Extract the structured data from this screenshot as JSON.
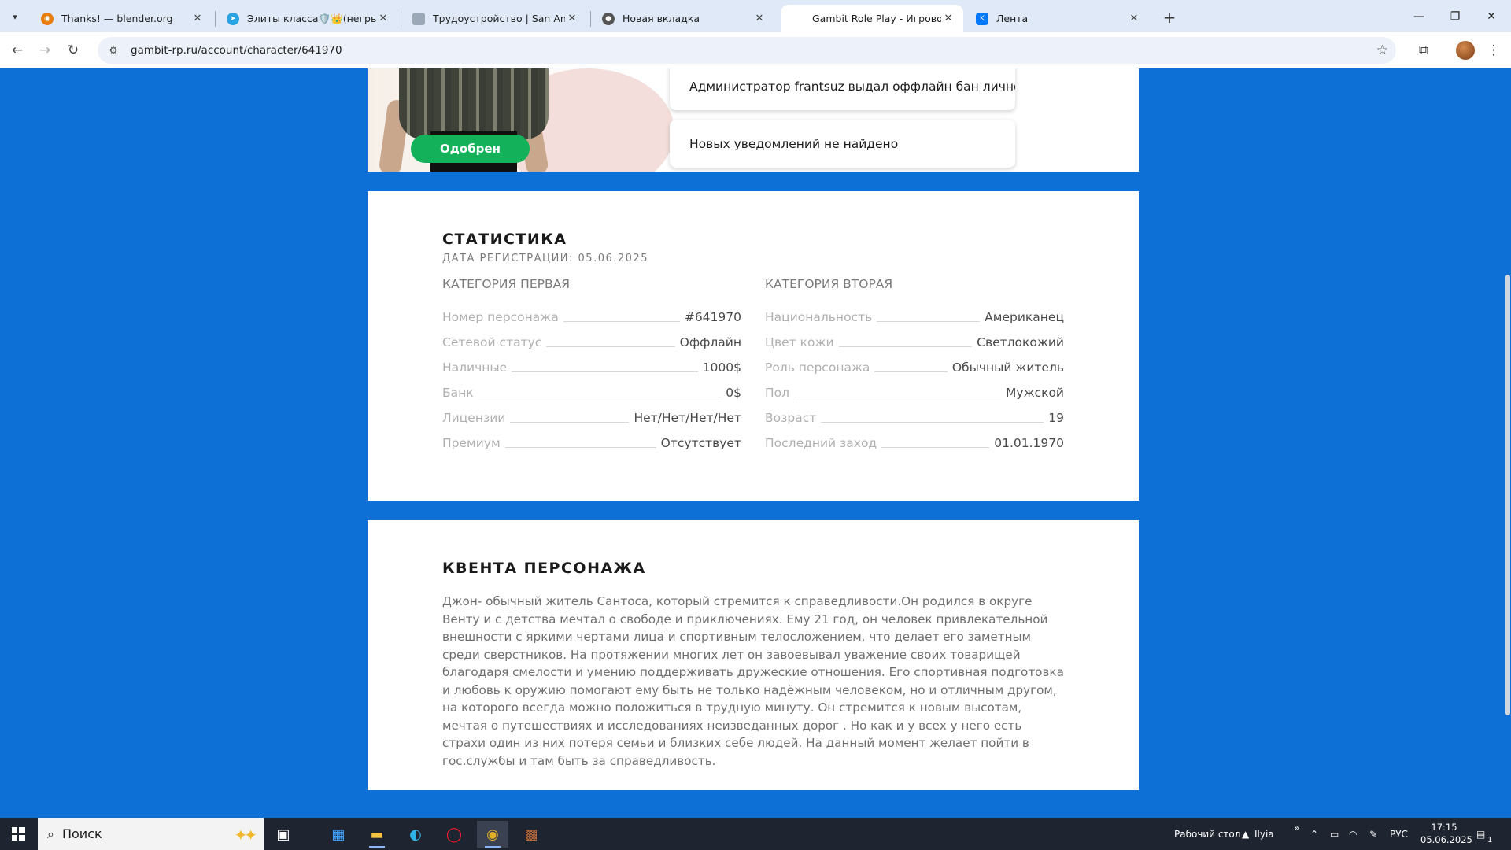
{
  "browser": {
    "tabs": [
      {
        "title": "Thanks! — blender.org",
        "icon": "blender-icon",
        "color": "#e87d0d"
      },
      {
        "title": "Элиты класса🛡️👑(негры)",
        "icon": "telegram-icon",
        "color": "#2aa3e0"
      },
      {
        "title": "Трудоустройство | San Andreas",
        "icon": "page-icon",
        "color": "#9aa8b8"
      },
      {
        "title": "Новая вкладка",
        "icon": "chrome-icon",
        "color": "#555555"
      },
      {
        "title": "Gambit Role Play - Игровой пр",
        "icon": "gambit-icon",
        "color": "#ffffff"
      },
      {
        "title": "Лента",
        "icon": "vk-icon",
        "color": "#0077ff"
      }
    ],
    "new_tab_label": "+",
    "url": "gambit-rp.ru/account/character/641970"
  },
  "character": {
    "status_badge": "Одобрен",
    "notifications": [
      "Администратор frantsuz выдал оффлайн бан лично...",
      "Новых уведомлений не найдено"
    ]
  },
  "stats": {
    "title": "СТАТИСТИКА",
    "registration": "ДАТА РЕГИСТРАЦИИ: 05.06.2025",
    "category_one": {
      "title": "КАТЕГОРИЯ ПЕРВАЯ",
      "rows": [
        {
          "label": "Номер персонажа",
          "value": "#641970"
        },
        {
          "label": "Сетевой статус",
          "value": "Оффлайн"
        },
        {
          "label": "Наличные",
          "value": "1000$"
        },
        {
          "label": "Банк",
          "value": "0$"
        },
        {
          "label": "Лицензии",
          "value": "Нет/Нет/Нет/Нет"
        },
        {
          "label": "Премиум",
          "value": "Отсутствует"
        }
      ]
    },
    "category_two": {
      "title": "КАТЕГОРИЯ ВТОРАЯ",
      "rows": [
        {
          "label": "Национальность",
          "value": "Американец"
        },
        {
          "label": "Цвет кожи",
          "value": "Светлокожий"
        },
        {
          "label": "Роль персонажа",
          "value": "Обычный житель"
        },
        {
          "label": "Пол",
          "value": "Мужской"
        },
        {
          "label": "Возраст",
          "value": "19"
        },
        {
          "label": "Последний заход",
          "value": "01.01.1970"
        }
      ]
    }
  },
  "story": {
    "title": "КВЕНТА ПЕРСОНАЖА",
    "text": "Джон- обычный житель Сантоса, который стремится к справедливости.Он родился в округе Венту и с детства мечтал о свободе и приключениях. Ему 21 год, он человек привлекательной внешности с яркими чертами лица и спортивным телосложением, что делает его заметным среди сверстников. На протяжении многих лет он завоевывал уважение своих товарищей благодаря смелости и умению поддерживать дружеские отношения. Его спортивная подготовка и любовь к оружию помогают ему быть не только надёжным человеком, но и отличным другом, на которого всегда можно положиться в трудную минуту. Он стремится к новым высотам, мечтая о путешествиях и исследованиях неизведанных дорог . Но как и у всех у него есть страхи один из них потеря семьи и близких себе людей. На данный момент желает пойти в гос.службы и там быть за справедливость."
  },
  "taskbar": {
    "search_placeholder": "Поиск",
    "desktop_label": "Рабочий стол",
    "user_label": "Ilyia",
    "language": "РУС",
    "time": "17:15",
    "date": "05.06.2025",
    "notification_count": "1"
  },
  "colors": {
    "page_bg": "#0d70d6",
    "approved_badge": "#12b15a"
  }
}
